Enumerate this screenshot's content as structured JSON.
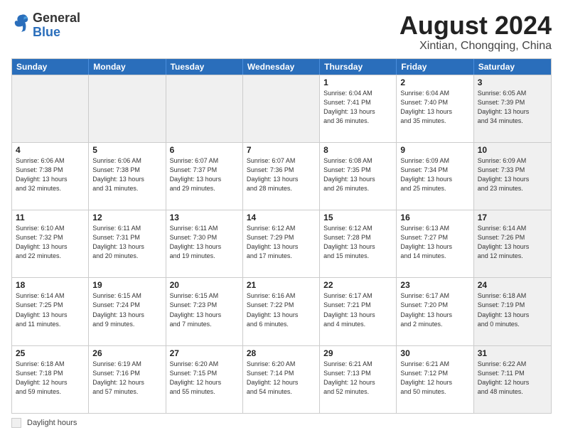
{
  "header": {
    "logo_general": "General",
    "logo_blue": "Blue",
    "title": "August 2024",
    "location": "Xintian, Chongqing, China"
  },
  "calendar": {
    "days_of_week": [
      "Sunday",
      "Monday",
      "Tuesday",
      "Wednesday",
      "Thursday",
      "Friday",
      "Saturday"
    ],
    "weeks": [
      [
        {
          "day": "",
          "text": "",
          "shaded": true
        },
        {
          "day": "",
          "text": "",
          "shaded": true
        },
        {
          "day": "",
          "text": "",
          "shaded": true
        },
        {
          "day": "",
          "text": "",
          "shaded": true
        },
        {
          "day": "1",
          "text": "Sunrise: 6:04 AM\nSunset: 7:41 PM\nDaylight: 13 hours\nand 36 minutes."
        },
        {
          "day": "2",
          "text": "Sunrise: 6:04 AM\nSunset: 7:40 PM\nDaylight: 13 hours\nand 35 minutes."
        },
        {
          "day": "3",
          "text": "Sunrise: 6:05 AM\nSunset: 7:39 PM\nDaylight: 13 hours\nand 34 minutes.",
          "shaded": true
        }
      ],
      [
        {
          "day": "4",
          "text": "Sunrise: 6:06 AM\nSunset: 7:38 PM\nDaylight: 13 hours\nand 32 minutes."
        },
        {
          "day": "5",
          "text": "Sunrise: 6:06 AM\nSunset: 7:38 PM\nDaylight: 13 hours\nand 31 minutes."
        },
        {
          "day": "6",
          "text": "Sunrise: 6:07 AM\nSunset: 7:37 PM\nDaylight: 13 hours\nand 29 minutes."
        },
        {
          "day": "7",
          "text": "Sunrise: 6:07 AM\nSunset: 7:36 PM\nDaylight: 13 hours\nand 28 minutes."
        },
        {
          "day": "8",
          "text": "Sunrise: 6:08 AM\nSunset: 7:35 PM\nDaylight: 13 hours\nand 26 minutes."
        },
        {
          "day": "9",
          "text": "Sunrise: 6:09 AM\nSunset: 7:34 PM\nDaylight: 13 hours\nand 25 minutes."
        },
        {
          "day": "10",
          "text": "Sunrise: 6:09 AM\nSunset: 7:33 PM\nDaylight: 13 hours\nand 23 minutes.",
          "shaded": true
        }
      ],
      [
        {
          "day": "11",
          "text": "Sunrise: 6:10 AM\nSunset: 7:32 PM\nDaylight: 13 hours\nand 22 minutes."
        },
        {
          "day": "12",
          "text": "Sunrise: 6:11 AM\nSunset: 7:31 PM\nDaylight: 13 hours\nand 20 minutes."
        },
        {
          "day": "13",
          "text": "Sunrise: 6:11 AM\nSunset: 7:30 PM\nDaylight: 13 hours\nand 19 minutes."
        },
        {
          "day": "14",
          "text": "Sunrise: 6:12 AM\nSunset: 7:29 PM\nDaylight: 13 hours\nand 17 minutes."
        },
        {
          "day": "15",
          "text": "Sunrise: 6:12 AM\nSunset: 7:28 PM\nDaylight: 13 hours\nand 15 minutes."
        },
        {
          "day": "16",
          "text": "Sunrise: 6:13 AM\nSunset: 7:27 PM\nDaylight: 13 hours\nand 14 minutes."
        },
        {
          "day": "17",
          "text": "Sunrise: 6:14 AM\nSunset: 7:26 PM\nDaylight: 13 hours\nand 12 minutes.",
          "shaded": true
        }
      ],
      [
        {
          "day": "18",
          "text": "Sunrise: 6:14 AM\nSunset: 7:25 PM\nDaylight: 13 hours\nand 11 minutes."
        },
        {
          "day": "19",
          "text": "Sunrise: 6:15 AM\nSunset: 7:24 PM\nDaylight: 13 hours\nand 9 minutes."
        },
        {
          "day": "20",
          "text": "Sunrise: 6:15 AM\nSunset: 7:23 PM\nDaylight: 13 hours\nand 7 minutes."
        },
        {
          "day": "21",
          "text": "Sunrise: 6:16 AM\nSunset: 7:22 PM\nDaylight: 13 hours\nand 6 minutes."
        },
        {
          "day": "22",
          "text": "Sunrise: 6:17 AM\nSunset: 7:21 PM\nDaylight: 13 hours\nand 4 minutes."
        },
        {
          "day": "23",
          "text": "Sunrise: 6:17 AM\nSunset: 7:20 PM\nDaylight: 13 hours\nand 2 minutes."
        },
        {
          "day": "24",
          "text": "Sunrise: 6:18 AM\nSunset: 7:19 PM\nDaylight: 13 hours\nand 0 minutes.",
          "shaded": true
        }
      ],
      [
        {
          "day": "25",
          "text": "Sunrise: 6:18 AM\nSunset: 7:18 PM\nDaylight: 12 hours\nand 59 minutes."
        },
        {
          "day": "26",
          "text": "Sunrise: 6:19 AM\nSunset: 7:16 PM\nDaylight: 12 hours\nand 57 minutes."
        },
        {
          "day": "27",
          "text": "Sunrise: 6:20 AM\nSunset: 7:15 PM\nDaylight: 12 hours\nand 55 minutes."
        },
        {
          "day": "28",
          "text": "Sunrise: 6:20 AM\nSunset: 7:14 PM\nDaylight: 12 hours\nand 54 minutes."
        },
        {
          "day": "29",
          "text": "Sunrise: 6:21 AM\nSunset: 7:13 PM\nDaylight: 12 hours\nand 52 minutes."
        },
        {
          "day": "30",
          "text": "Sunrise: 6:21 AM\nSunset: 7:12 PM\nDaylight: 12 hours\nand 50 minutes."
        },
        {
          "day": "31",
          "text": "Sunrise: 6:22 AM\nSunset: 7:11 PM\nDaylight: 12 hours\nand 48 minutes.",
          "shaded": true
        }
      ]
    ]
  },
  "legend": {
    "box_label": "Daylight hours"
  }
}
